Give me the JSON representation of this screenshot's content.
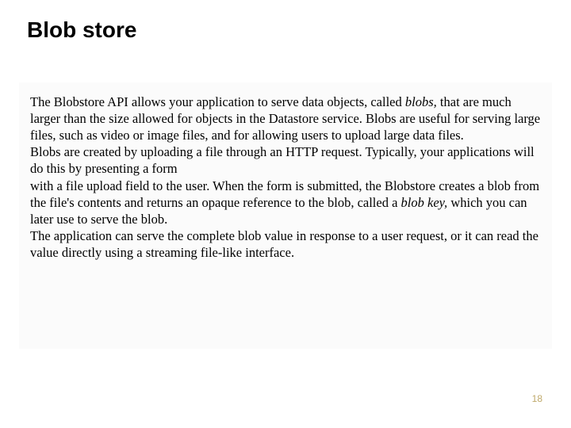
{
  "title": "Blob store",
  "paragraphs": {
    "p1a": "The Blobstore API allows your application to serve data objects, called ",
    "p1_italic": "blobs,",
    "p1b": " that are much larger than the size allowed  for objects in the Datastore service. Blobs are useful for serving large files, such as video or image files, and for allowing users  to upload large data files.",
    "p2": " Blobs are created by uploading a file through an HTTP request. Typically, your applications will do this by presenting a form",
    "p3a": "with a file upload field to the user. When the form is submitted, the Blobstore  creates a blob from the file's contents and  returns an opaque reference to the  blob, called a ",
    "p3_italic": "blob key,",
    "p3b": " which you can later use to serve the blob.",
    "p4": "The application can serve the complete blob value in response to a user request,  or it can read the value directly using a streaming file-like interface."
  },
  "page_number": "18"
}
